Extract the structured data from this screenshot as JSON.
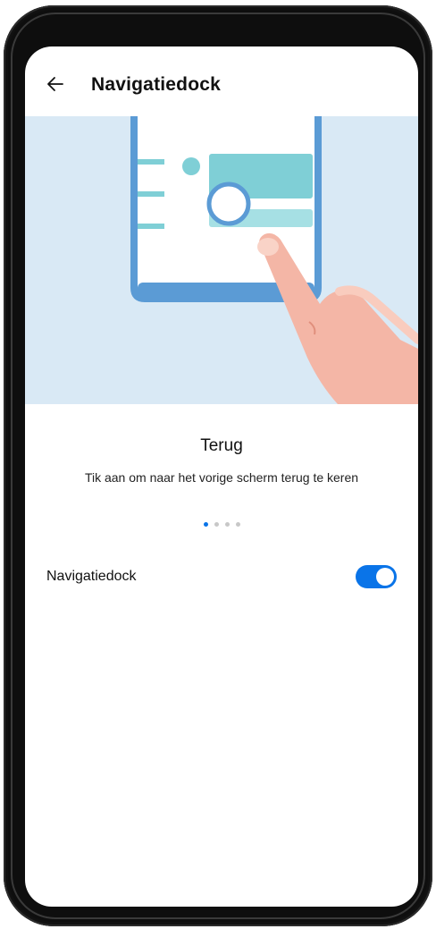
{
  "header": {
    "back_icon": "arrow-left-icon",
    "title": "Navigatiedock"
  },
  "illustration": {
    "icon": "navigation-dock-illustration",
    "colors": {
      "background": "#d9e9f5",
      "phone_frame": "#5b9bd5",
      "card": "#7fcfd6",
      "dock_circle": "#ffffff",
      "hand": "#f4b6a6"
    }
  },
  "hint": {
    "title": "Terug",
    "description": "Tik aan om naar het vorige scherm terug te keren"
  },
  "pager": {
    "total": 4,
    "active_index": 0
  },
  "setting": {
    "label": "Navigatiedock",
    "enabled": true
  },
  "colors": {
    "accent": "#0a74e8"
  }
}
